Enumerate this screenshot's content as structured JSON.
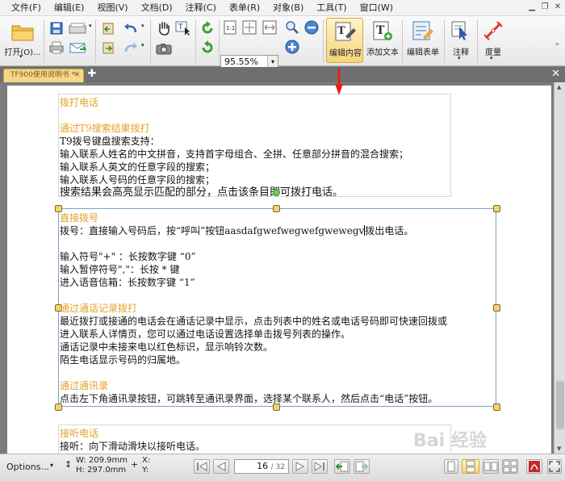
{
  "menu": [
    "文件(F)",
    "编辑(E)",
    "视图(V)",
    "文档(D)",
    "注释(C)",
    "表单(R)",
    "对象(B)",
    "工具(T)",
    "窗口(W)"
  ],
  "toolbar": {
    "open_label": "打开(O)...",
    "zoom_value": "95.55%",
    "edit_content_label": "编辑内容",
    "add_text_label": "添加文本",
    "edit_form_label": "编辑表单",
    "annotate_label": "注释",
    "measure_label": "度量"
  },
  "tab": {
    "title": "TF900使用说明书 *"
  },
  "document": {
    "block1": {
      "heading": "拨打电话",
      "subheading": "通过T9搜索结果拨打",
      "lines": [
        "T9拨号键盘搜索支持：",
        "输入联系人姓名的中文拼音，支持首字母组合、全拼、任意部分拼音的混合搜索；",
        "输入联系人英文的任意字段的搜索；",
        "输入联系人号码的任意字段的搜索；",
        "搜索结果会高亮显示匹配的部分，点击该条目即可拨打电话。"
      ]
    },
    "block2": {
      "heading": "直接拨号",
      "dial_line_before": "拨号：直接输入号码后，按“呼叫”按钮aasdafgwefwegwefgwewegv",
      "dial_line_after": "拨出电话。",
      "symbol_lines": [
        "输入符号\"+\" ：长按数字键 “0”",
        "输入暂停符号\",\"：长按 * 键",
        "进入语音信箱：长按数字键 “1”"
      ],
      "call_log_heading": "通过通话记录拨打",
      "call_log_lines": [
        "最近拨打或接通的电话会在通话记录中显示，点击列表中的姓名或电话号码即可快速回拨或",
        "进入联系人详情页，您可以通过电话设置选择单击拨号列表的操作。",
        "通话记录中未接来电以红色标识，显示响铃次数。",
        "陌生电话显示号码的归属地。"
      ],
      "contacts_heading": "通过通讯录",
      "contacts_line": "点击左下角通讯录按钮，可跳转至通讯录界面，选择某个联系人，然后点击“电话”按钮。"
    },
    "block3": {
      "heading": "接听电话",
      "line": "接听：向下滑动滑块以接听电话。"
    }
  },
  "status": {
    "options_label": "Options...",
    "width_label": "W: 209.9mm",
    "height_label": "H: 297.0mm",
    "x_label": "X:",
    "y_label": "Y:",
    "current_page": "16",
    "total_pages": "/ 32"
  },
  "watermark": "Bai 经验",
  "colors": {
    "accent": "#e6a028",
    "selection": "#7aa3c9",
    "tab": "#f6d788"
  }
}
